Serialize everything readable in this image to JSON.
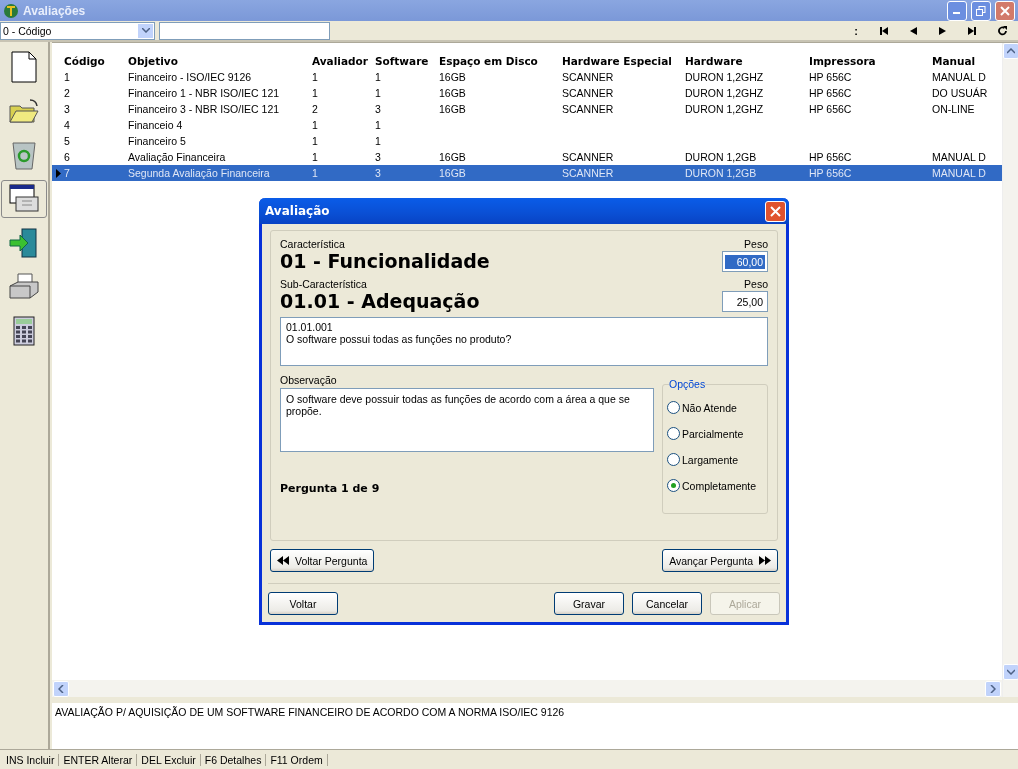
{
  "window": {
    "title": "Avaliações"
  },
  "toolbar": {
    "sort_combo": {
      "value": "0 - Código"
    },
    "separator": ":"
  },
  "tools": [
    {
      "kind": "new",
      "selected": false
    },
    {
      "kind": "open",
      "selected": false
    },
    {
      "kind": "delete",
      "selected": false
    },
    {
      "kind": "edit",
      "selected": true
    },
    {
      "kind": "exit",
      "selected": false
    },
    {
      "kind": "print",
      "selected": false
    },
    {
      "kind": "calculator",
      "selected": false
    }
  ],
  "table": {
    "columns": [
      "Código",
      "Objetivo",
      "Avaliador",
      "Software",
      "Espaço em Disco",
      "Hardware Especial",
      "Hardware",
      "Impressora",
      "Manual"
    ],
    "rows": [
      {
        "selected": false,
        "cells": [
          "1",
          "Financeiro - ISO/IEC 9126",
          "1",
          "1",
          "16GB",
          "SCANNER",
          "DURON 1,2GHZ",
          "HP 656C",
          "MANUAL D"
        ]
      },
      {
        "selected": false,
        "cells": [
          "2",
          "Financeiro 1 - NBR ISO/IEC 121",
          "1",
          "1",
          "16GB",
          "SCANNER",
          "DURON 1,2GHZ",
          "HP 656C",
          "DO USUÁR"
        ]
      },
      {
        "selected": false,
        "cells": [
          "3",
          "Financeiro 3 - NBR ISO/IEC 121",
          "2",
          "3",
          "16GB",
          "SCANNER",
          "DURON 1,2GHZ",
          "HP 656C",
          "ON-LINE"
        ]
      },
      {
        "selected": false,
        "cells": [
          "4",
          "Financeio 4",
          "1",
          "1",
          "",
          "",
          "",
          "",
          ""
        ]
      },
      {
        "selected": false,
        "cells": [
          "5",
          "Financeiro 5",
          "1",
          "1",
          "",
          "",
          "",
          "",
          ""
        ]
      },
      {
        "selected": false,
        "cells": [
          "6",
          "Avaliação Financeira",
          "1",
          "3",
          "16GB",
          "SCANNER",
          "DURON 1,2GB",
          "HP 656C",
          "MANUAL D"
        ]
      },
      {
        "selected": true,
        "cells": [
          "7",
          "Segunda Avaliação Financeira",
          "1",
          "3",
          "16GB",
          "SCANNER",
          "DURON 1,2GB",
          "HP 656C",
          "MANUAL D"
        ]
      }
    ]
  },
  "description": "AVALIAÇÃO P/ AQUISIÇÃO DE UM SOFTWARE FINANCEIRO DE ACORDO COM A NORMA ISO/IEC 9126",
  "status_bar": [
    "INS Incluir",
    "ENTER Alterar",
    "DEL Excluir",
    "F6 Detalhes",
    "F11 Ordem"
  ],
  "dialog": {
    "title": "Avaliação",
    "characteristic": {
      "label": "Característica",
      "value": "01 - Funcionalidade",
      "weight_label": "Peso",
      "weight": "60,00",
      "focused": true
    },
    "sub_characteristic": {
      "label": "Sub-Característica",
      "value": "01.01 - Adequação",
      "weight_label": "Peso",
      "weight": "25,00",
      "focused": false
    },
    "question": {
      "code": "01.01.001",
      "text": "O software possui todas as funções no produto?"
    },
    "observation": {
      "label": "Observação",
      "text": "O software deve possuir todas as funções de acordo com a área a que se propõe."
    },
    "options": {
      "legend": "Opções",
      "items": [
        {
          "label": "Não Atende",
          "selected": false
        },
        {
          "label": "Parcialmente",
          "selected": false
        },
        {
          "label": "Largamente",
          "selected": false
        },
        {
          "label": "Completamente",
          "selected": true
        }
      ]
    },
    "counter": "Pergunta 1 de 9",
    "prev_button": "Voltar Pergunta",
    "next_button": "Avançar Pergunta",
    "buttons": [
      {
        "label": "Voltar",
        "disabled": false
      },
      {
        "label": "Gravar",
        "disabled": false
      },
      {
        "label": "Cancelar",
        "disabled": false
      },
      {
        "label": "Aplicar",
        "disabled": true
      }
    ]
  }
}
